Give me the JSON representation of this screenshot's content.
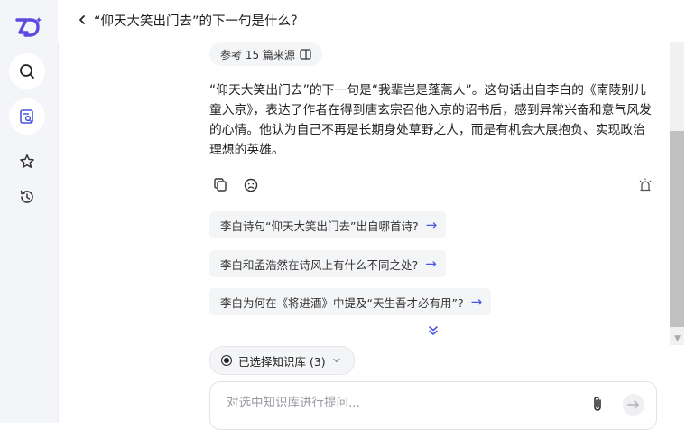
{
  "header": {
    "title": "“仰天大笑出门去”的下一句是什么？"
  },
  "sidebar": {
    "logo": "zhida-logo",
    "items": [
      {
        "name": "search",
        "icon": "search-icon"
      },
      {
        "name": "knowledge-search",
        "icon": "doc-search-icon",
        "active": true
      },
      {
        "name": "favorites",
        "icon": "star-icon"
      },
      {
        "name": "history",
        "icon": "history-icon"
      }
    ]
  },
  "sources": {
    "label": "参考 15 篇来源"
  },
  "answer": {
    "text": "“仰天大笑出门去”的下一句是“我辈岂是蓬蒿人”。这句话出自李白的《南陵别儿童入京》，表达了作者在得到唐玄宗召他入京的诏书后，感到异常兴奋和意气风发的心情。他认为自己不再是长期身处草野之人，而是有机会大展抱负、实现政治理想的英雄。"
  },
  "suggestions": [
    {
      "text": "李白诗句“仰天大笑出门去”出自哪首诗?"
    },
    {
      "text": "李白和孟浩然在诗风上有什么不同之处?"
    },
    {
      "text": "李白为何在《将进酒》中提及“天生吾才必有用”?"
    }
  ],
  "knowledge_base": {
    "label": "已选择知识库 (3)"
  },
  "input": {
    "placeholder": "对选中知识库进行提问..."
  },
  "colors": {
    "accent": "#4a55e0",
    "logo": "#5b4be0"
  }
}
